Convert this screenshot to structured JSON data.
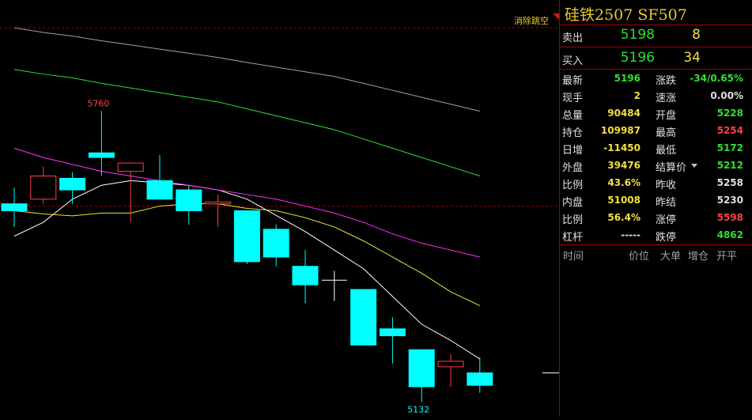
{
  "header": {
    "title": "硅铁2507  SF507"
  },
  "orderbook": {
    "sell": {
      "label": "卖出",
      "price": "5198",
      "volume": "8"
    },
    "buy": {
      "label": "买入",
      "price": "5196",
      "volume": "34"
    }
  },
  "chart_label": "消除跳空",
  "stats_left": [
    {
      "label": "最新",
      "value": "5196",
      "color": "#2ee02e"
    },
    {
      "label": "现手",
      "value": "2",
      "color": "#f0e040"
    },
    {
      "label": "总量",
      "value": "90484",
      "color": "#f0e040"
    },
    {
      "label": "持仓",
      "value": "109987",
      "color": "#f0e040"
    },
    {
      "label": "日增",
      "value": "-11450",
      "color": "#f0e040"
    },
    {
      "label": "外盘",
      "value": "39476",
      "color": "#f0e040"
    },
    {
      "label": "比例",
      "value": "43.6%",
      "color": "#f0e040"
    },
    {
      "label": "内盘",
      "value": "51008",
      "color": "#f0e040"
    },
    {
      "label": "比例",
      "value": "56.4%",
      "color": "#f0e040"
    },
    {
      "label": "杠杆",
      "value": "-----",
      "color": "#e0e0e0"
    }
  ],
  "stats_right": [
    {
      "label": "涨跌",
      "value": "-34/0.65%",
      "color": "#2ee02e"
    },
    {
      "label": "速涨",
      "value": "0.00%",
      "color": "#e0e0e0"
    },
    {
      "label": "开盘",
      "value": "5228",
      "color": "#2ee02e"
    },
    {
      "label": "最高",
      "value": "5254",
      "color": "#ff4040"
    },
    {
      "label": "最低",
      "value": "5172",
      "color": "#2ee02e"
    },
    {
      "label": "结算价",
      "value": "5212",
      "color": "#2ee02e"
    },
    {
      "label": "昨收",
      "value": "5258",
      "color": "#e0e0e0"
    },
    {
      "label": "昨结",
      "value": "5230",
      "color": "#e0e0e0"
    },
    {
      "label": "涨停",
      "value": "5598",
      "color": "#ff4040"
    },
    {
      "label": "跌停",
      "value": "4862",
      "color": "#2ee02e"
    }
  ],
  "ticket_headers": [
    "时间",
    "价位",
    "大单",
    "增仓",
    "开平"
  ],
  "chart_data": {
    "type": "candlestick",
    "high_label": "5760",
    "low_label": "5132",
    "ylim": [
      5100,
      6000
    ],
    "candles": [
      {
        "o": 5560,
        "h": 5595,
        "l": 5510,
        "c": 5545,
        "dir": "down"
      },
      {
        "o": 5570,
        "h": 5640,
        "l": 5560,
        "c": 5620,
        "dir": "up"
      },
      {
        "o": 5615,
        "h": 5628,
        "l": 5560,
        "c": 5590,
        "dir": "down"
      },
      {
        "o": 5670,
        "h": 5760,
        "l": 5620,
        "c": 5660,
        "dir": "down"
      },
      {
        "o": 5630,
        "h": 5640,
        "l": 5520,
        "c": 5648,
        "dir": "up"
      },
      {
        "o": 5610,
        "h": 5665,
        "l": 5580,
        "c": 5570,
        "dir": "down"
      },
      {
        "o": 5590,
        "h": 5600,
        "l": 5515,
        "c": 5545,
        "dir": "down"
      },
      {
        "o": 5560,
        "h": 5580,
        "l": 5510,
        "c": 5564,
        "dir": "up"
      },
      {
        "o": 5545,
        "h": 5545,
        "l": 5430,
        "c": 5435,
        "dir": "down"
      },
      {
        "o": 5505,
        "h": 5515,
        "l": 5425,
        "c": 5445,
        "dir": "down"
      },
      {
        "o": 5425,
        "h": 5460,
        "l": 5345,
        "c": 5385,
        "dir": "down"
      },
      {
        "o": 5395,
        "h": 5415,
        "l": 5350,
        "c": 5395,
        "dir": "doji"
      },
      {
        "o": 5375,
        "h": 5375,
        "l": 5255,
        "c": 5255,
        "dir": "down"
      },
      {
        "o": 5290,
        "h": 5315,
        "l": 5215,
        "c": 5275,
        "dir": "down"
      },
      {
        "o": 5245,
        "h": 5245,
        "l": 5132,
        "c": 5165,
        "dir": "down"
      },
      {
        "o": 5220,
        "h": 5235,
        "l": 5165,
        "c": 5208,
        "dir": "up"
      },
      {
        "o": 5195,
        "h": 5228,
        "l": 5152,
        "c": 5168,
        "dir": "down"
      }
    ],
    "moving_averages": [
      {
        "color": "#ffffff",
        "values": [
          5490,
          5520,
          5570,
          5600,
          5610,
          5605,
          5600,
          5590,
          5570,
          5535,
          5500,
          5460,
          5420,
          5360,
          5300,
          5265,
          5225
        ]
      },
      {
        "color": "#f0e040",
        "values": [
          5545,
          5538,
          5534,
          5540,
          5540,
          5555,
          5560,
          5560,
          5550,
          5545,
          5530,
          5510,
          5480,
          5445,
          5410,
          5370,
          5340
        ]
      },
      {
        "color": "#ff30ff",
        "values": [
          5680,
          5660,
          5645,
          5630,
          5620,
          5610,
          5600,
          5590,
          5580,
          5570,
          5555,
          5540,
          5520,
          5495,
          5475,
          5460,
          5445
        ]
      },
      {
        "color": "#30e030",
        "values": [
          5850,
          5840,
          5832,
          5820,
          5810,
          5800,
          5790,
          5780,
          5765,
          5750,
          5735,
          5720,
          5700,
          5680,
          5660,
          5640,
          5620
        ]
      },
      {
        "color": "#a0a0a0",
        "values": [
          5940,
          5930,
          5922,
          5912,
          5903,
          5894,
          5885,
          5876,
          5865,
          5855,
          5845,
          5835,
          5820,
          5805,
          5790,
          5775,
          5760
        ]
      }
    ],
    "ref_lines": [
      {
        "value": 5940,
        "color": "#a00000"
      },
      {
        "value": 5555,
        "color": "#a00000"
      }
    ],
    "last_price_tick": 5195
  }
}
